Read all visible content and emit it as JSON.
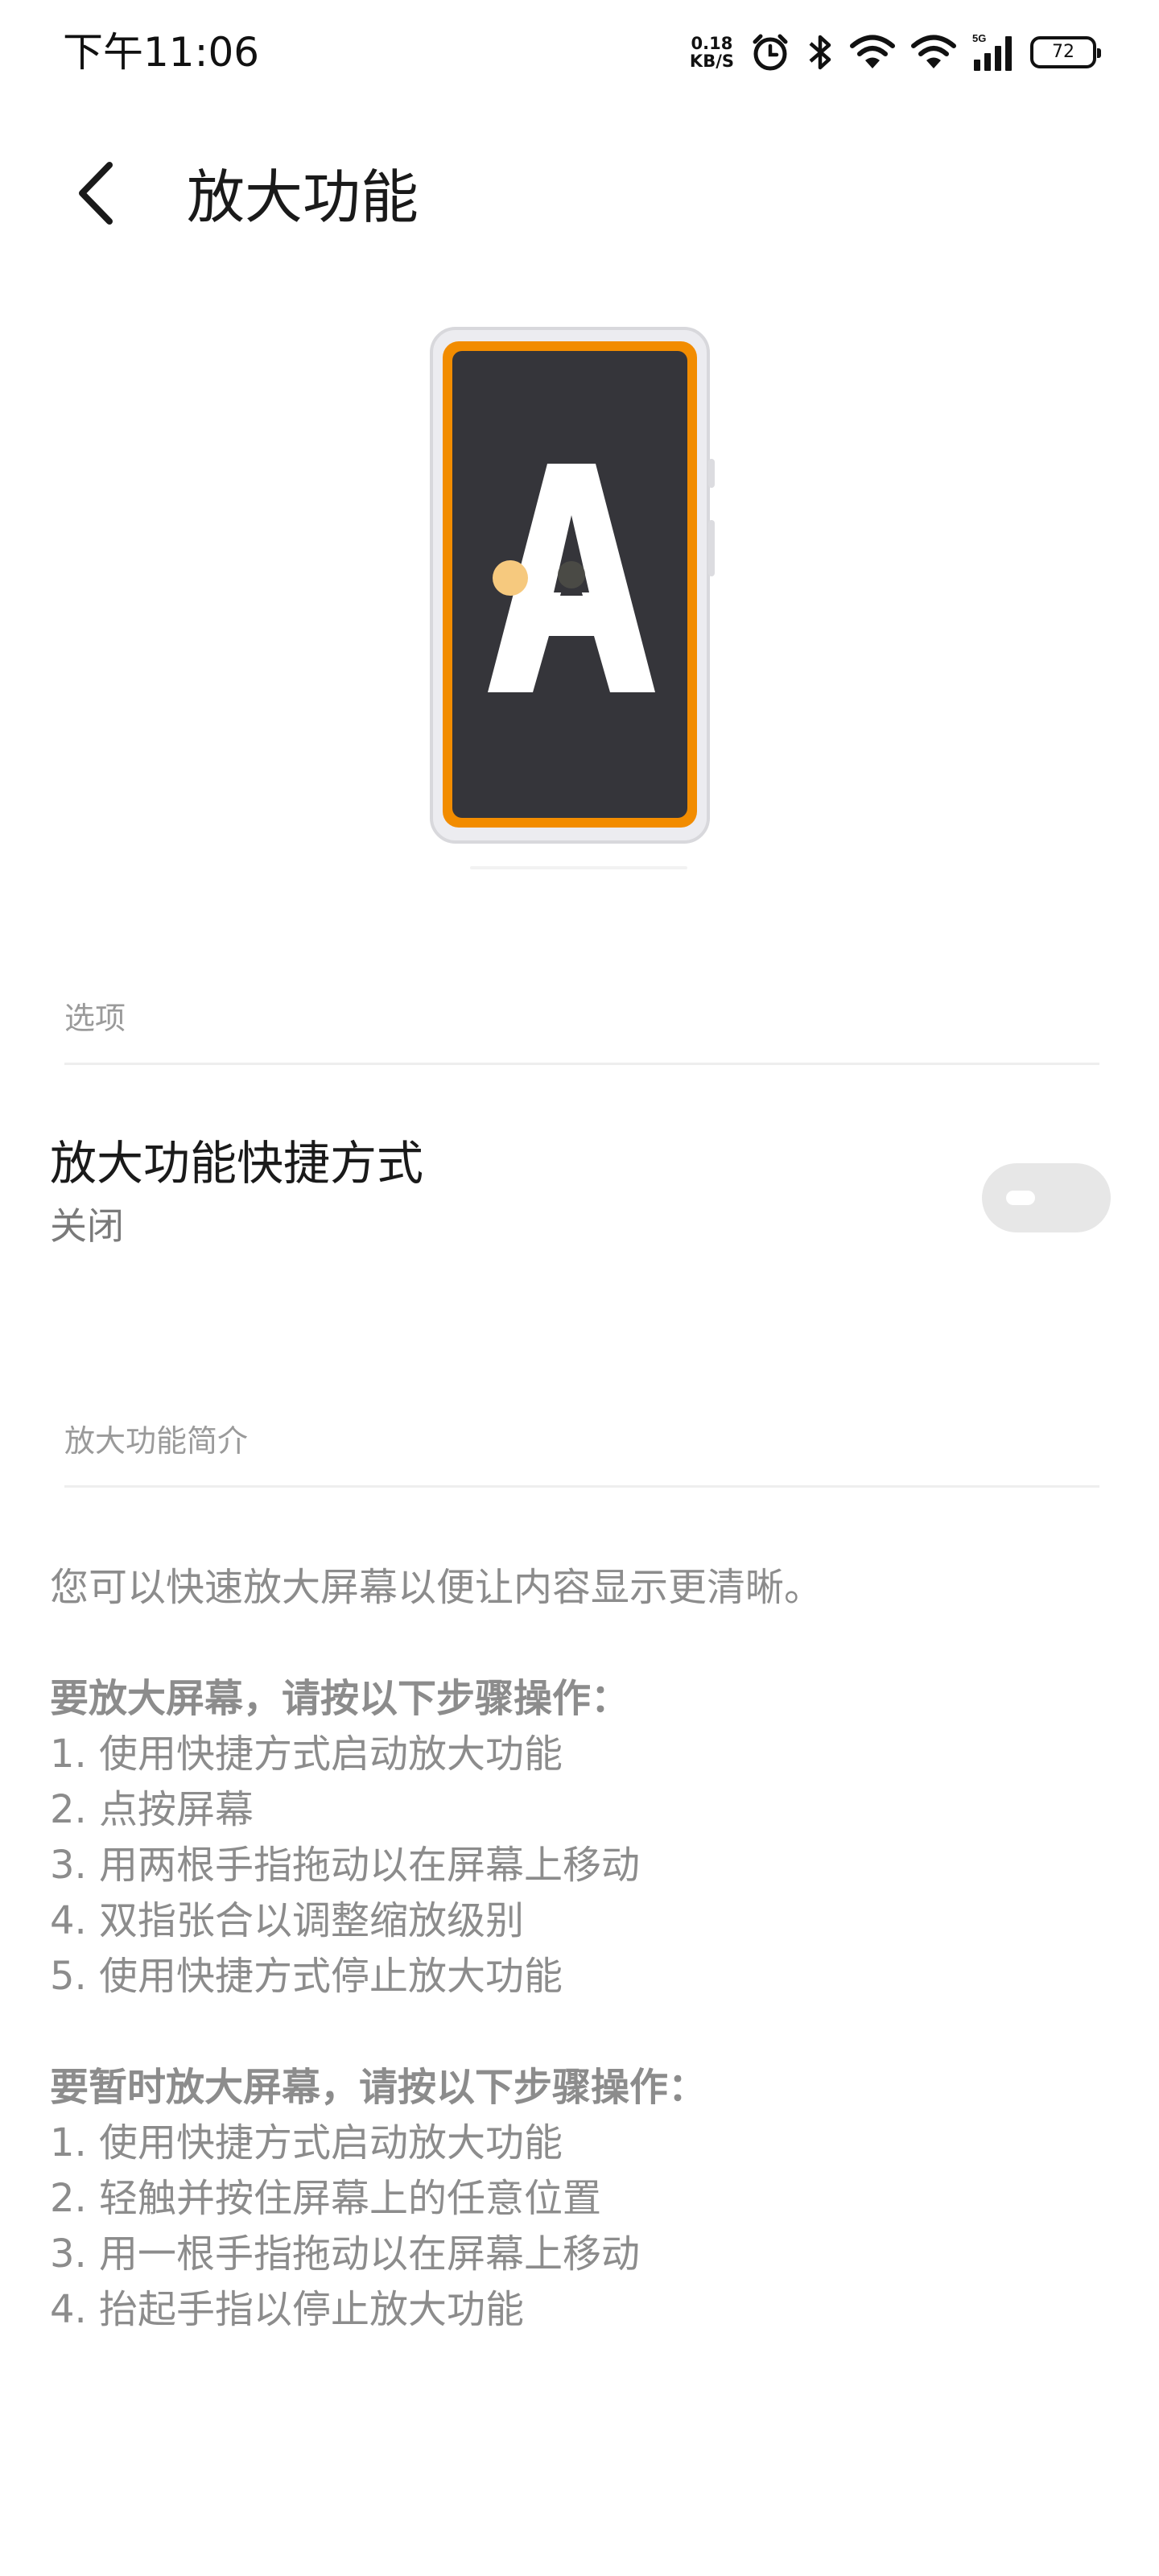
{
  "status_bar": {
    "time": "下午11:06",
    "net_speed_value": "0.18",
    "net_speed_unit": "KB/S",
    "signal_label": "5G",
    "battery": "72",
    "icons": [
      "alarm-icon",
      "bluetooth-icon",
      "wifi-icon",
      "wifi-icon",
      "cellular-signal-icon",
      "battery-icon"
    ]
  },
  "header": {
    "back_icon": "chevron-left-icon",
    "title": "放大功能"
  },
  "illustration": {
    "letter": "A",
    "colors": {
      "frame": "#e6e6ea",
      "border": "#f28c00",
      "screen": "#35353a",
      "touch": "#f6c97e"
    }
  },
  "sections": {
    "options": "选项",
    "intro": "放大功能简介"
  },
  "shortcut": {
    "title": "放大功能快捷方式",
    "status": "关闭",
    "enabled": false
  },
  "intro_text": {
    "line1": "您可以快速放大屏幕以便让内容显示更清晰。",
    "group1_title": "要放大屏幕，请按以下步骤操作：",
    "group1_steps": [
      "1. 使用快捷方式启动放大功能",
      "2. 点按屏幕",
      "3. 用两根手指拖动以在屏幕上移动",
      "4. 双指张合以调整缩放级别",
      "5. 使用快捷方式停止放大功能"
    ],
    "group2_title": "要暂时放大屏幕，请按以下步骤操作：",
    "group2_steps": [
      "1. 使用快捷方式启动放大功能",
      "2. 轻触并按住屏幕上的任意位置",
      "3. 用一根手指拖动以在屏幕上移动",
      "4. 抬起手指以停止放大功能"
    ]
  }
}
